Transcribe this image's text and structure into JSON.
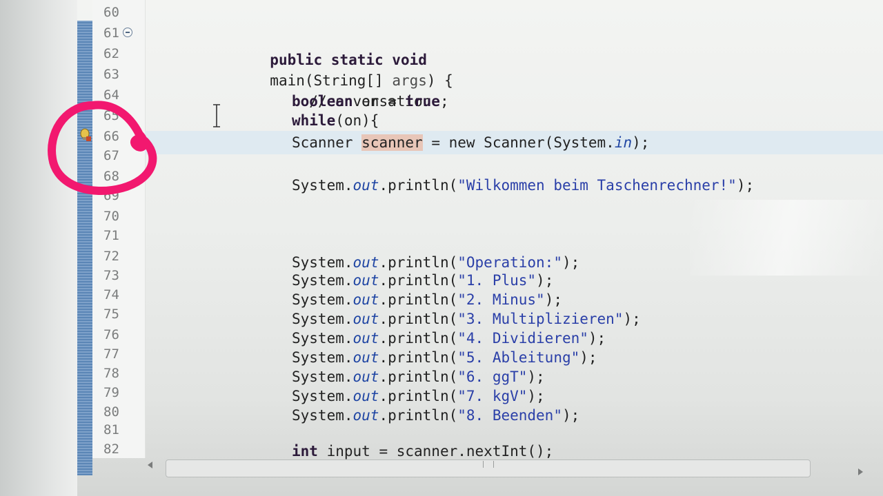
{
  "gutter": {
    "line_numbers": [
      "60",
      "61",
      "62",
      "63",
      "64",
      "65",
      "66",
      "67",
      "68",
      "69",
      "70",
      "71",
      "72",
      "73",
      "74",
      "75",
      "76",
      "77",
      "78",
      "79",
      "80",
      "81",
      "82"
    ]
  },
  "code": {
    "main_sig": {
      "kw": "public static void",
      "rest": "main(String[] ",
      "param": "args",
      "tail": ") {"
    },
    "comment": "//conversation",
    "bool_line": {
      "kw1": "boolean",
      "mid": " on = ",
      "kw2": "true",
      "end": ";"
    },
    "while_line": {
      "kw": "while",
      "rest": "(on){"
    },
    "scanner_line": {
      "type": "Scanner ",
      "var": "scanner",
      "mid": " = new Scanner(System.",
      "field": "in",
      "end": ");"
    },
    "welcome": {
      "pre": "System.",
      "field": "out",
      "call": ".println(",
      "str": "\"Wilkommen beim Taschenrechner!\"",
      "end": ");"
    },
    "println_lines": [
      {
        "pre": "System.",
        "field": "out",
        "call": ".println(",
        "str": "\"Operation:\"",
        "end": ");"
      },
      {
        "pre": "System.",
        "field": "out",
        "call": ".println(",
        "str": "\"1. Plus\"",
        "end": ");"
      },
      {
        "pre": "System.",
        "field": "out",
        "call": ".println(",
        "str": "\"2. Minus\"",
        "end": ");"
      },
      {
        "pre": "System.",
        "field": "out",
        "call": ".println(",
        "str": "\"3. Multiplizieren\"",
        "end": ");"
      },
      {
        "pre": "System.",
        "field": "out",
        "call": ".println(",
        "str": "\"4. Dividieren\"",
        "end": ");"
      },
      {
        "pre": "System.",
        "field": "out",
        "call": ".println(",
        "str": "\"5. Ableitung\"",
        "end": ");"
      },
      {
        "pre": "System.",
        "field": "out",
        "call": ".println(",
        "str": "\"6. ggT\"",
        "end": ");"
      },
      {
        "pre": "System.",
        "field": "out",
        "call": ".println(",
        "str": "\"7. kgV\"",
        "end": ");"
      },
      {
        "pre": "System.",
        "field": "out",
        "call": ".println(",
        "str": "\"8. Beenden\"",
        "end": ");"
      }
    ],
    "input_line": {
      "kw": "int",
      "rest": " input = scanner.nextInt();"
    }
  },
  "icons": {
    "fold": "collapse-fold-icon",
    "warning": "warning-lightbulb-icon",
    "cursor": "text-cursor-icon"
  },
  "colors": {
    "annotation_circle": "#f2186f",
    "ruler_blue": "#5b86b6",
    "keyword": "#2c1a3a",
    "string": "#2a3fa8",
    "static_field": "#1f45a3"
  }
}
